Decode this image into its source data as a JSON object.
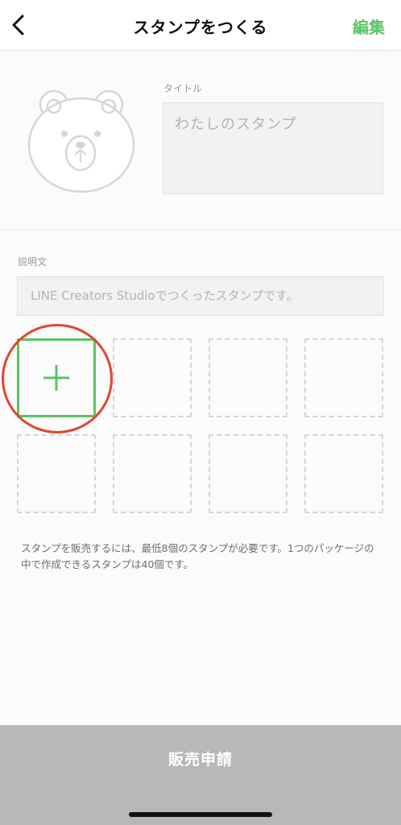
{
  "header": {
    "title": "スタンプをつくる",
    "edit_label": "編集",
    "back_icon": "chevron-left-icon"
  },
  "cover": {
    "icon": "bear-face-placeholder-icon"
  },
  "title_field": {
    "label": "タイトル",
    "placeholder": "わたしのスタンプ"
  },
  "description_field": {
    "label": "説明文",
    "placeholder": "LINE Creators Studioでつくったスタンプです。"
  },
  "sticker_grid": {
    "add_icon": "plus-icon",
    "empty_slots": 7
  },
  "note": "スタンプを販売するには、最低8個のスタンプが必要です。1つのパッケージの中で作成できるスタンプは40個です。",
  "submit": {
    "label": "販売申請"
  },
  "colors": {
    "accent": "#5ac563",
    "highlight": "#e0462e",
    "submit_bar": "#b8b8b9"
  }
}
